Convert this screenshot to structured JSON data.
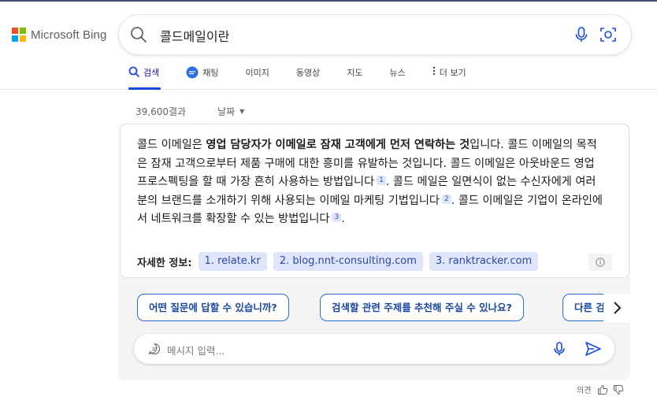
{
  "brand": {
    "logo_text": "Microsoft Bing",
    "colors": [
      "#f25022",
      "#7fba00",
      "#00a4ef",
      "#ffb900"
    ]
  },
  "search": {
    "query": "콜드메일이란"
  },
  "tabs": [
    {
      "label": "검색",
      "icon": "search-icon",
      "active": true
    },
    {
      "label": "채팅",
      "icon": "chat-bubble-icon",
      "active": false
    },
    {
      "label": "이미지",
      "active": false
    },
    {
      "label": "동영상",
      "active": false
    },
    {
      "label": "지도",
      "active": false
    },
    {
      "label": "뉴스",
      "active": false
    },
    {
      "label": "더 보기",
      "icon": "more-vertical-icon",
      "active": false
    }
  ],
  "results": {
    "count": "39,600결과",
    "date_filter": "날짜"
  },
  "answer": {
    "t1": "콜드 이메일은 ",
    "b1": "영업 담당자가 이메일로 잠재 고객에게 먼저 연락하는 것",
    "t2": "입니다. 콜드 이메일의 목적은 잠재 고객으로부터 제품 구매에 대한 흥미를 유발하는 것입니다. 콜드 이메일은 아웃바운드 영업 프로스펙팅을 할 때 가장 흔히 사용하는 방법입니다",
    "c1": "1",
    "t3": ". 콜드 메일은 일면식이 없는 수신자에게 여러분의 브랜드를 소개하기 위해 사용되는 이메일 마케팅 기법입니다",
    "c2": "2",
    "t4": ". 콜드 이메일은 기업이 온라인에서 네트워크를 확장할 수 있는 방법입니다",
    "c3": "3",
    "t5": "."
  },
  "more_info": {
    "label": "자세한 정보:",
    "sources": [
      "1. relate.kr",
      "2. blog.nnt-consulting.com",
      "3. ranktracker.com"
    ]
  },
  "suggestions": [
    "어떤 질문에 답할 수 있습니까?",
    "검색할 관련 주제를 추천해 주실 수 있나요?",
    "다른 검"
  ],
  "chat": {
    "placeholder": "메시지 입력..."
  },
  "feedback": {
    "label": "의견"
  },
  "accent": "#174ae4"
}
